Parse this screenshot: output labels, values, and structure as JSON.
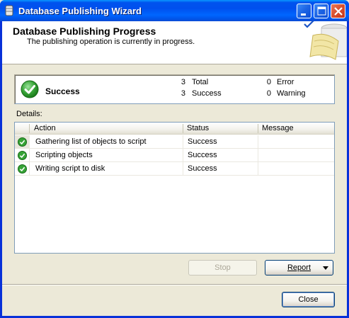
{
  "window": {
    "title": "Database Publishing Wizard"
  },
  "header": {
    "title": "Database Publishing Progress",
    "subtitle": "The publishing operation is currently in progress."
  },
  "summary": {
    "status": "Success",
    "total_count": "3",
    "total_label": "Total",
    "success_count": "3",
    "success_label": "Success",
    "error_count": "0",
    "error_label": "Error",
    "warning_count": "0",
    "warning_label": "Warning"
  },
  "details": {
    "label": "Details:",
    "columns": [
      "Action",
      "Status",
      "Message"
    ],
    "rows": [
      {
        "icon": "success-check-icon",
        "action": "Gathering list of objects to script",
        "status": "Success",
        "message": ""
      },
      {
        "icon": "success-check-icon",
        "action": "Scripting objects",
        "status": "Success",
        "message": ""
      },
      {
        "icon": "success-check-icon",
        "action": "Writing script to disk",
        "status": "Success",
        "message": ""
      }
    ]
  },
  "buttons": {
    "stop": "Stop",
    "report": "Report",
    "close": "Close"
  },
  "colors": {
    "titlebar": "#0054E3",
    "success_green": "#2E9A2E",
    "dialog_bg": "#ECE9D8"
  }
}
